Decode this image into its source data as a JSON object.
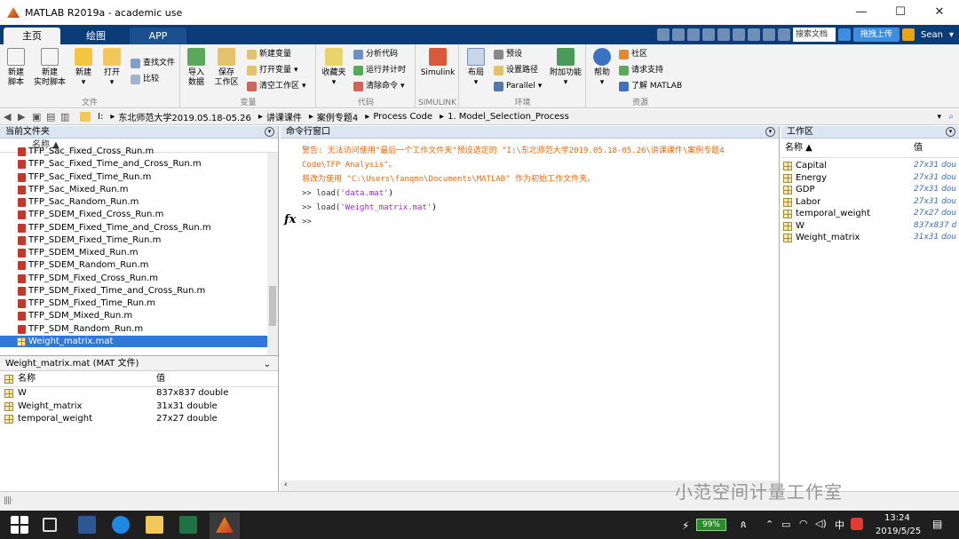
{
  "window": {
    "title": "MATLAB R2019a - academic use"
  },
  "tabs": [
    {
      "label": "主页",
      "active": true
    },
    {
      "label": "绘图",
      "active": false
    },
    {
      "label": "APP",
      "active": false
    }
  ],
  "topbar": {
    "search_placeholder": "搜索文档",
    "upload_label": "拖拽上传",
    "user": "Sean"
  },
  "ribbon": {
    "groups": {
      "file": "文件",
      "variable": "变量",
      "code": "代码",
      "simulink": "SIMULINK",
      "env": "环境",
      "resources": "资源"
    },
    "new_script": "新建\n脚本",
    "new_live_script": "新建\n实时脚本",
    "new": "新建",
    "open": "打开",
    "find_files": "查找文件",
    "compare": "比较",
    "import": "导入\n数据",
    "save_ws": "保存\n工作区",
    "new_var": "新建变量",
    "open_var": "打开变量",
    "clear_ws": "清空工作区",
    "favorites": "收藏夹",
    "analyze_code": "分析代码",
    "run_time": "运行并计时",
    "clear_cmd": "清除命令",
    "simulink": "Simulink",
    "layout": "布局",
    "prefs": "预设",
    "set_path": "设置路径",
    "parallel": "Parallel",
    "addons": "附加功能",
    "help": "帮助",
    "community": "社区",
    "request_support": "请求支持",
    "learn_matlab": "了解 MATLAB"
  },
  "address": {
    "crumbs": [
      "I:",
      "东北师范大学2019.05.18-05.26",
      "讲课课件",
      "案例专题4",
      "Process Code",
      "1. Model_Selection_Process"
    ]
  },
  "current_folder": {
    "title": "当前文件夹",
    "col_name": "名称 ▲",
    "files": [
      "TFP_Sac_Fixed_Cross_Run.m",
      "TFP_Sac_Fixed_Time_and_Cross_Run.m",
      "TFP_Sac_Fixed_Time_Run.m",
      "TFP_Sac_Mixed_Run.m",
      "TFP_Sac_Random_Run.m",
      "TFP_SDEM_Fixed_Cross_Run.m",
      "TFP_SDEM_Fixed_Time_and_Cross_Run.m",
      "TFP_SDEM_Fixed_Time_Run.m",
      "TFP_SDEM_Mixed_Run.m",
      "TFP_SDEM_Random_Run.m",
      "TFP_SDM_Fixed_Cross_Run.m",
      "TFP_SDM_Fixed_Time_and_Cross_Run.m",
      "TFP_SDM_Fixed_Time_Run.m",
      "TFP_SDM_Mixed_Run.m",
      "TFP_SDM_Random_Run.m"
    ],
    "selected_file": "Weight_matrix.mat"
  },
  "details": {
    "title": "Weight_matrix.mat  (MAT 文件)",
    "col_name": "名称",
    "col_value": "值",
    "rows": [
      {
        "name": "W",
        "value": "837x837 double"
      },
      {
        "name": "Weight_matrix",
        "value": "31x31 double"
      },
      {
        "name": "temporal_weight",
        "value": "27x27 double"
      }
    ]
  },
  "command_window": {
    "title": "命令行窗口",
    "warning_line1": "警告: 无法访问使用\"最后一个工作文件夹\"预设选定的 \"I:\\东北师范大学2019.05.18-05.26\\讲课课件\\案例专题4",
    "warning_line2": "Code\\TFP Analysis\"。",
    "warning_line3": "将改为使用 \"C:\\Users\\fanqmn\\Documents\\MATLAB\" 作为初始工作文件夹。",
    "cmd1_prefix": ">> load(",
    "cmd1_arg": "'data.mat'",
    "cmd1_suffix": ")",
    "cmd2_prefix": ">> load(",
    "cmd2_arg": "'Weight_matrix.mat'",
    "cmd2_suffix": ")",
    "prompt": ">>",
    "fx": "fx"
  },
  "workspace": {
    "title": "工作区",
    "col_name": "名称 ▲",
    "col_value": "值",
    "vars": [
      {
        "name": "Capital",
        "value": "27x31 dou"
      },
      {
        "name": "Energy",
        "value": "27x31 dou"
      },
      {
        "name": "GDP",
        "value": "27x31 dou"
      },
      {
        "name": "Labor",
        "value": "27x31 dou"
      },
      {
        "name": "temporal_weight",
        "value": "27x27 dou"
      },
      {
        "name": "W",
        "value": "837x837 d"
      },
      {
        "name": "Weight_matrix",
        "value": "31x31 dou"
      }
    ]
  },
  "taskbar": {
    "battery": "99%",
    "ime": "中",
    "time": "13:24",
    "date": "2019/5/25"
  },
  "watermark": "小范空间计量工作室"
}
